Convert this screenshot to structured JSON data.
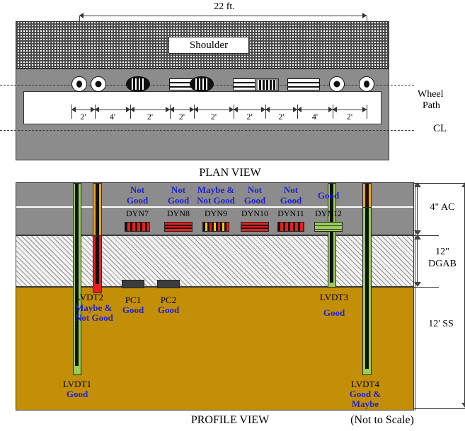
{
  "figure": {
    "plan_caption": "PLAN VIEW",
    "profile_caption": "PROFILE VIEW",
    "scale_note": "(Not to Scale)"
  },
  "plan": {
    "overall_dimension": "22 ft.",
    "shoulder_label": "Shoulder",
    "wheel_path_label_line1": "Wheel",
    "wheel_path_label_line2": "Path",
    "centerline_label": "CL",
    "segment_dimensions": [
      "2'",
      "4'",
      "2'",
      "2'",
      "2'",
      "2'",
      "2'",
      "4'",
      "2'"
    ],
    "sensors": [
      {
        "name": "lvdt-circle-left-outer",
        "type": "circle"
      },
      {
        "name": "lvdt-circle-left-inner",
        "type": "circle"
      },
      {
        "name": "coil-dark-1",
        "type": "coil-dark"
      },
      {
        "name": "strip-1",
        "type": "strip"
      },
      {
        "name": "coil-dark-2",
        "type": "coil-dark"
      },
      {
        "name": "strip-2",
        "type": "strip"
      },
      {
        "name": "coil-gray-1",
        "type": "coil-gray"
      },
      {
        "name": "strip-3",
        "type": "strip"
      },
      {
        "name": "lvdt-circle-right-inner",
        "type": "circle"
      },
      {
        "name": "lvdt-circle-right-outer",
        "type": "circle"
      }
    ]
  },
  "profile": {
    "layers": [
      {
        "key": "ac",
        "thickness_label_line1": "4\" AC",
        "thickness_label_line2": ""
      },
      {
        "key": "dgab",
        "thickness_label_line1": "12\"",
        "thickness_label_line2": "DGAB"
      },
      {
        "key": "ss",
        "thickness_label_line1": "12' SS",
        "thickness_label_line2": ""
      }
    ],
    "dyn_sensors": [
      {
        "id": "DYN7",
        "status_line1": "Not",
        "status_line2": "Good",
        "style": "bars-red"
      },
      {
        "id": "DYN8",
        "status_line1": "Not",
        "status_line2": "Good",
        "style": "lines-red"
      },
      {
        "id": "DYN9",
        "status_line1": "Maybe &",
        "status_line2": "Not Good",
        "style": "bars-mix"
      },
      {
        "id": "DYN10",
        "status_line1": "Not",
        "status_line2": "Good",
        "style": "lines-red"
      },
      {
        "id": "DYN11",
        "status_line1": "Not",
        "status_line2": "Good",
        "style": "bars-red"
      },
      {
        "id": "DYN12",
        "status_line1": "Good",
        "status_line2": "",
        "style": "green"
      }
    ],
    "instruments": [
      {
        "id": "LVDT1",
        "status_line1": "Good",
        "status_line2": ""
      },
      {
        "id": "LVDT2",
        "status_line1": "Maybe &",
        "status_line2": "Not Good"
      },
      {
        "id": "PC1",
        "status_line1": "Good",
        "status_line2": ""
      },
      {
        "id": "PC2",
        "status_line1": "Good",
        "status_line2": ""
      },
      {
        "id": "LVDT3",
        "status_line1": "Good",
        "status_line2": ""
      },
      {
        "id": "LVDT4",
        "status_line1": "Good &",
        "status_line2": "Maybe"
      }
    ]
  },
  "colors": {
    "status_text": "#2222cc",
    "asphalt": "#8c8c8c",
    "subgrade": "#c28f07",
    "rod_green": "#9acd55",
    "rod_orange": "#f5a60a",
    "rod_red": "#ef1c1c",
    "pc_gray": "#3d3d3d"
  }
}
